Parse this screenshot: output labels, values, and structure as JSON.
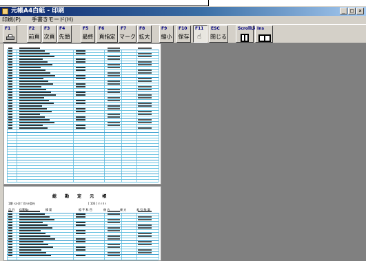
{
  "window": {
    "title": "元帳A4白紙 - 印刷",
    "controls": [
      "_",
      "□",
      "×"
    ]
  },
  "menu": {
    "items": [
      "印刷(P)",
      "手書きモード(H)"
    ]
  },
  "toolbar": {
    "buttons": [
      {
        "key": "F1",
        "label": "",
        "icon": "printer-icon"
      },
      {
        "key": "F2",
        "label": "前頁"
      },
      {
        "key": "F3",
        "label": "次頁"
      },
      {
        "key": "F4",
        "label": "先頭"
      },
      {
        "key": "F5",
        "label": "最終"
      },
      {
        "key": "F6",
        "label": "頁指定"
      },
      {
        "key": "F7",
        "label": "マーク"
      },
      {
        "key": "F8",
        "label": "拡大"
      },
      {
        "key": "F9",
        "label": "縮小"
      },
      {
        "key": "F10",
        "label": "保存"
      },
      {
        "key": "F11",
        "label": "",
        "icon": "hand-pointer-icon"
      },
      {
        "key": "ESC",
        "label": "閉じる"
      },
      {
        "key": "ScrollLk",
        "label": "",
        "icon": "single-page-icon"
      },
      {
        "key": "Ins",
        "label": "",
        "icon": "two-page-icon"
      }
    ]
  },
  "preview": {
    "page2_title": "総 勘 定 元 帳",
    "page2_header_left": "1期  ﾃｽﾄ(ｶﾌﾞ)ｶｸｼｷ会社",
    "page2_header_right": "[ 103   ]   ﾀ   ﾒ    ﾀ    ﾒ",
    "page2_columns": [
      "月 日",
      "伝票No",
      "摘   要",
      "相 手 科 目",
      "借   方",
      "貸   方",
      "差 引 残 高"
    ]
  },
  "colors": {
    "titlebar_start": "#0a246a",
    "titlebar_end": "#a6caf0",
    "ledger_line": "#66c2e0",
    "preview_background": "#808080"
  }
}
